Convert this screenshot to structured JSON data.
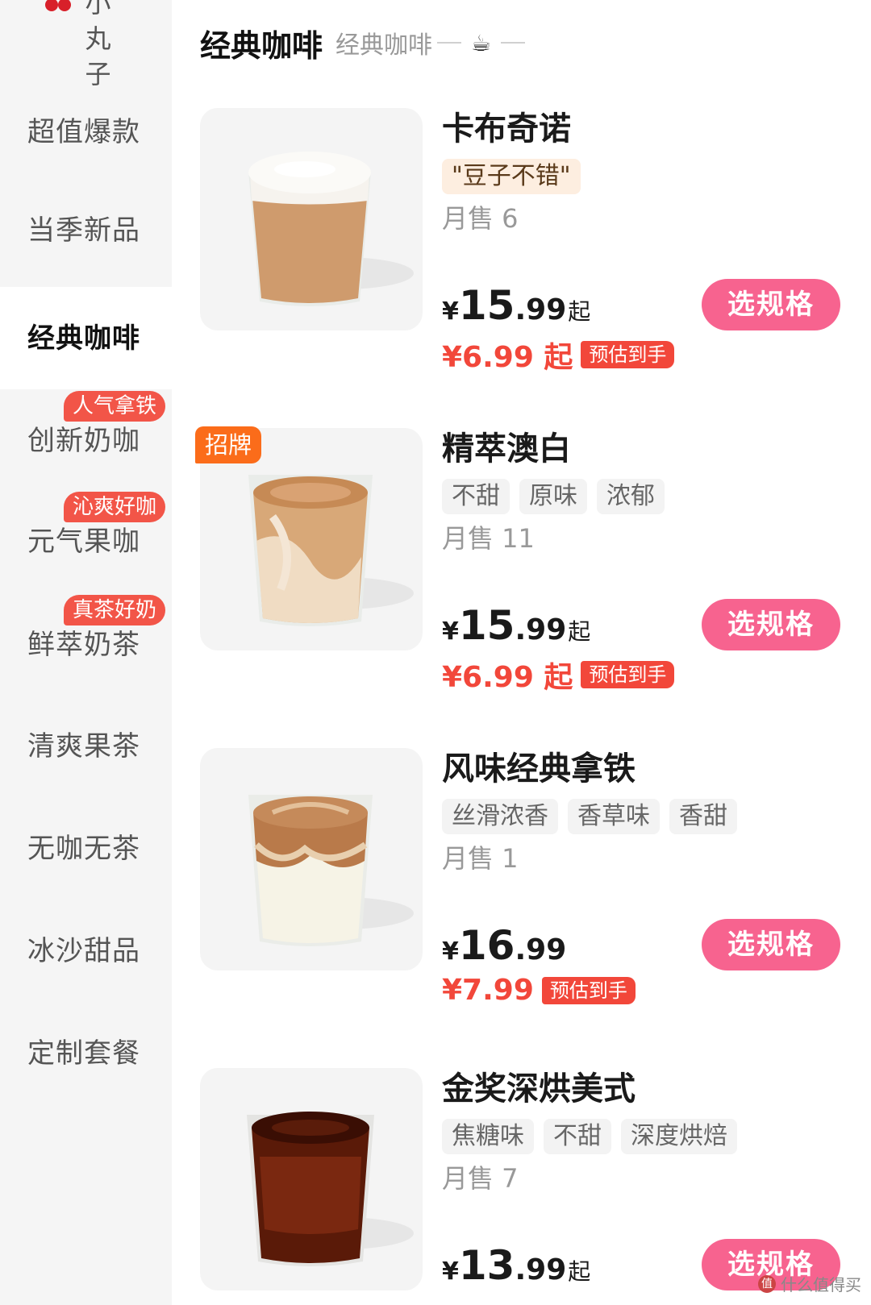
{
  "sidebar": {
    "partial_item": "小丸子",
    "items": [
      {
        "label": "超值爆款"
      },
      {
        "label": "当季新品"
      },
      {
        "label": "经典咖啡"
      },
      {
        "label": "创新奶咖",
        "badge": "人气拿铁"
      },
      {
        "label": "元气果咖",
        "badge": "沁爽好咖"
      },
      {
        "label": "鲜萃奶茶",
        "badge": "真茶好奶"
      },
      {
        "label": "清爽果茶"
      },
      {
        "label": "无咖无茶"
      },
      {
        "label": "冰沙甜品"
      },
      {
        "label": "定制套餐"
      }
    ]
  },
  "header": {
    "title": "经典咖啡",
    "subtitle": "经典咖啡"
  },
  "products": [
    {
      "name": "卡布奇诺",
      "tags": [
        "\"豆子不错\""
      ],
      "sold": "月售 6",
      "price_yen": "¥",
      "price_int": "15",
      "price_dec": ".99",
      "price_from": "起",
      "est_price": "¥6.99 起",
      "est_label": "预估到手",
      "button": "选规格"
    },
    {
      "name": "精萃澳白",
      "badge": "招牌",
      "tags": [
        "不甜",
        "原味",
        "浓郁"
      ],
      "sold": "月售 11",
      "price_yen": "¥",
      "price_int": "15",
      "price_dec": ".99",
      "price_from": "起",
      "est_price": "¥6.99 起",
      "est_label": "预估到手",
      "button": "选规格"
    },
    {
      "name": "风味经典拿铁",
      "tags": [
        "丝滑浓香",
        "香草味",
        "香甜"
      ],
      "sold": "月售 1",
      "price_yen": "¥",
      "price_int": "16",
      "price_dec": ".99",
      "price_from": "",
      "est_price": "¥7.99",
      "est_label": "预估到手",
      "button": "选规格"
    },
    {
      "name": "金奖深烘美式",
      "tags": [
        "焦糖味",
        "不甜",
        "深度烘焙"
      ],
      "sold": "月售 7",
      "price_yen": "¥",
      "price_int": "13",
      "price_dec": ".99",
      "price_from": "起",
      "button": "选规格"
    }
  ],
  "watermark": "什么值得买"
}
